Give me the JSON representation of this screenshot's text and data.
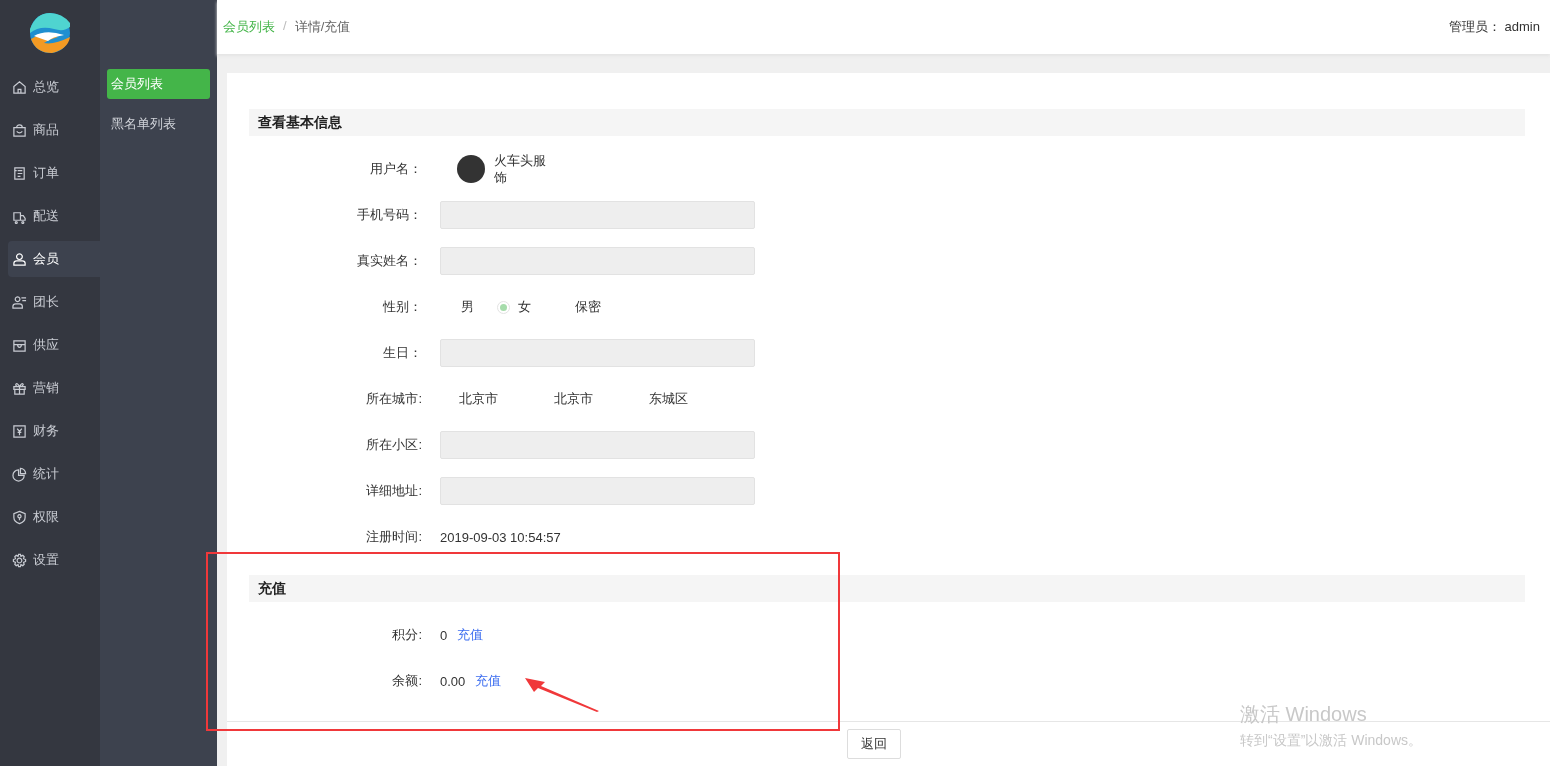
{
  "nav": {
    "items": [
      {
        "label": "总览",
        "selected": false
      },
      {
        "label": "商品",
        "selected": false
      },
      {
        "label": "订单",
        "selected": false
      },
      {
        "label": "配送",
        "selected": false
      },
      {
        "label": "会员",
        "selected": true
      },
      {
        "label": "团长",
        "selected": false
      },
      {
        "label": "供应",
        "selected": false
      },
      {
        "label": "营销",
        "selected": false
      },
      {
        "label": "财务",
        "selected": false
      },
      {
        "label": "统计",
        "selected": false
      },
      {
        "label": "权限",
        "selected": false
      },
      {
        "label": "设置",
        "selected": false
      }
    ]
  },
  "subnav": {
    "items": [
      {
        "label": "会员列表",
        "selected": true
      },
      {
        "label": "黑名单列表",
        "selected": false
      }
    ]
  },
  "breadcrumb": [
    {
      "label": "会员列表",
      "kind": "link"
    },
    {
      "label": "/",
      "kind": "sep"
    },
    {
      "label": "详情/充值",
      "kind": "current"
    }
  ],
  "header": {
    "user_label": "管理员：",
    "user": "admin"
  },
  "sections": [
    {
      "title": "查看基本信息",
      "rows": [
        {
          "kind": "user",
          "label": "用户名：",
          "value": "火车头服饰"
        },
        {
          "kind": "input",
          "label": "手机号码："
        },
        {
          "kind": "input",
          "label": "真实姓名："
        },
        {
          "kind": "radio",
          "label": "性别：",
          "options": [
            {
              "label": "男",
              "selected": false
            },
            {
              "label": "女",
              "selected": true
            },
            {
              "label": "保密",
              "selected": false
            }
          ]
        },
        {
          "kind": "input",
          "label": "生日："
        },
        {
          "kind": "cities",
          "label": "所在城市:",
          "values": [
            "北京市",
            "北京市",
            "东城区"
          ]
        },
        {
          "kind": "input",
          "label": "所在小区:"
        },
        {
          "kind": "input",
          "label": "详细地址:"
        },
        {
          "kind": "text",
          "label": "注册时间:",
          "value": "2019-09-03 10:54:57"
        }
      ]
    },
    {
      "title": "充值",
      "rows": [
        {
          "kind": "recharge",
          "label": "积分:",
          "value": "0",
          "link": "充值"
        },
        {
          "kind": "recharge",
          "label": "余额:",
          "value": "0.00",
          "link": "充值"
        }
      ]
    }
  ],
  "footer": {
    "button": "返回"
  },
  "os_overlay": {
    "title": "激活 Windows",
    "text": "转到“设置”以激活 Windows。"
  }
}
